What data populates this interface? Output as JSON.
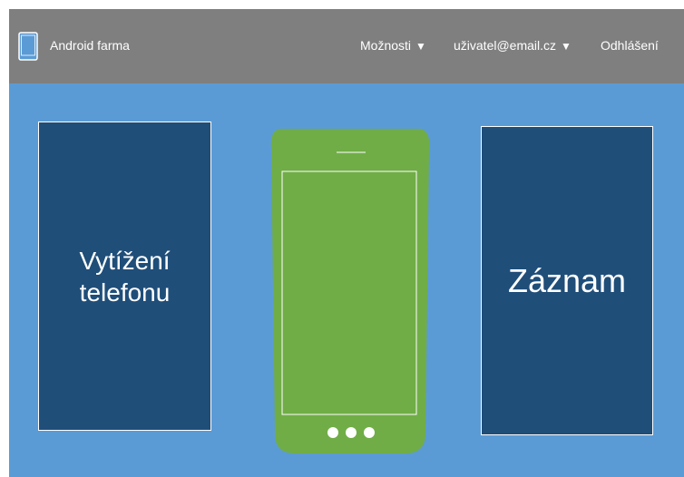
{
  "header": {
    "app_title": "Android farma",
    "app_icon": "tablet-icon",
    "menu_options": "Možnosti",
    "user_email": "uživatel@email.cz",
    "caret": "▼",
    "logout": "Odhlášení"
  },
  "main": {
    "phone_load_line1": "Vytížení",
    "phone_load_line2": "telefonu",
    "record_label": "Záznam"
  },
  "colors": {
    "background": "#5b9bd5",
    "header": "#7f7f7f",
    "panel": "#1f4e79",
    "phone": "#70ad47"
  }
}
